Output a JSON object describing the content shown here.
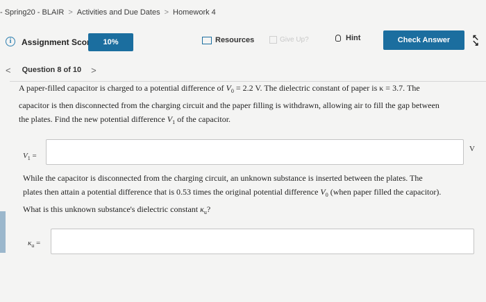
{
  "breadcrumb": {
    "course": "- Spring20 - BLAIR",
    "section": "Activities and Due Dates",
    "assignment": "Homework 4",
    "separator": ">"
  },
  "toolbar": {
    "score_label": "Assignment Score:",
    "score_value": "10%",
    "resources_label": "Resources",
    "giveup_label": "Give Up?",
    "hint_label": "Hint",
    "check_answer_label": "Check Answer",
    "info_symbol": "i"
  },
  "question_nav": {
    "prev": "<",
    "label": "Question 8 of 10",
    "next": ">"
  },
  "question": {
    "part1": {
      "line1": "A paper-filled capacitor is charged to a potential difference of",
      "v0_symbol": "V",
      "v0_sub": "0",
      "eq1": " = 2.2 V. The dielectric constant of paper is κ = 3.7. The",
      "line2": "capacitor is then disconnected from the charging circuit and the paper filling is withdrawn, allowing air to fill the gap between",
      "line3_a": "the plates. Find the new potential difference ",
      "v1_symbol": "V",
      "v1_sub": "1",
      "line3_b": " of the capacitor.",
      "answer_label_sym": "V",
      "answer_label_sub": "1",
      "answer_label_eq": " =",
      "answer_value": "",
      "unit": "V"
    },
    "part2": {
      "line1": "While the capacitor is disconnected from the charging circuit, an unknown substance is inserted between the plates. The",
      "line2_a": "plates then attain a potential difference that is 0.53 times the original potential difference ",
      "v0_symbol": "V",
      "v0_sub": "0",
      "line2_b": " (when paper filled the capacitor).",
      "line3_a": "What is this unknown substance's dielectric constant ",
      "kappa_symbol": "κ",
      "kappa_sub": "u",
      "line3_b": "?",
      "answer_label_sym": "κ",
      "answer_label_sub": "u",
      "answer_label_eq": " =",
      "answer_value": ""
    }
  },
  "colors": {
    "accent": "#1b6e9f",
    "background": "#f4f4f3"
  }
}
